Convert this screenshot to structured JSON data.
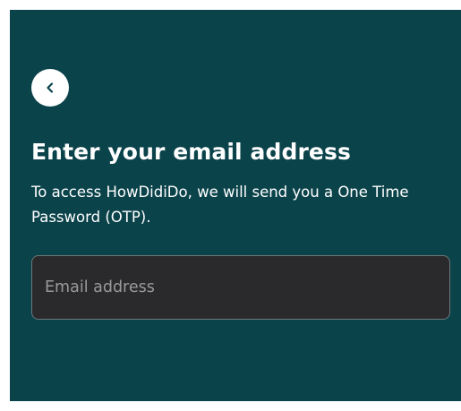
{
  "screen": {
    "title": "Enter your email address",
    "subtitle": "To access HowDidiDo, we will send you a One Time Password (OTP)."
  },
  "back_button": {
    "icon": "chevron-left-icon"
  },
  "email_field": {
    "value": "",
    "placeholder": "Email address"
  },
  "colors": {
    "background": "#0b434b",
    "input_background": "#2a2a2c",
    "text": "#ffffff"
  }
}
